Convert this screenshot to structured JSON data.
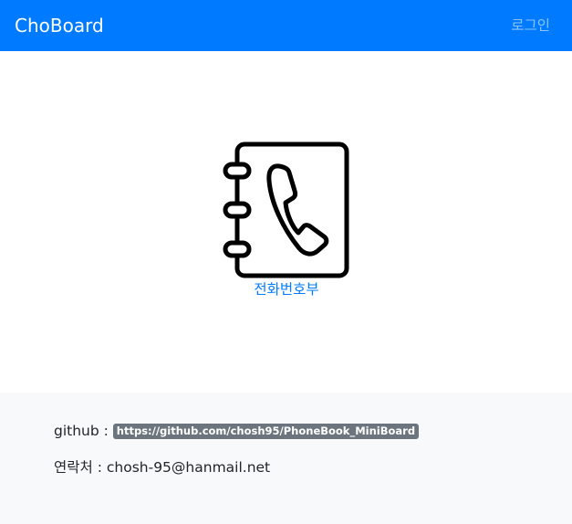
{
  "navbar": {
    "brand": "ChoBoard",
    "login_label": "로그인",
    "background_color": "#007bff"
  },
  "main": {
    "phonebook": {
      "icon": "phonebook-icon",
      "label": "전화번호부",
      "link_color": "#007bff"
    }
  },
  "footer": {
    "github_label": "github :",
    "github_url": "https://github.com/chosh95/PhoneBook_MiniBoard",
    "contact_label": "연락처 :",
    "contact_email": "chosh-95@hanmail.net",
    "badge_color": "#6c757d",
    "background_color": "#f8f9fa"
  }
}
